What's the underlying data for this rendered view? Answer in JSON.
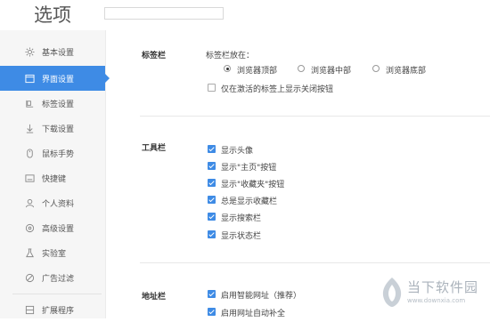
{
  "header": {
    "title": "选项",
    "search_value": ""
  },
  "sidebar": {
    "items": [
      {
        "label": "基本设置",
        "icon": "gear-icon"
      },
      {
        "label": "界面设置",
        "icon": "window-icon"
      },
      {
        "label": "标签设置",
        "icon": "tab-icon"
      },
      {
        "label": "下载设置",
        "icon": "download-icon"
      },
      {
        "label": "鼠标手势",
        "icon": "mouse-icon"
      },
      {
        "label": "快捷键",
        "icon": "keyboard-icon"
      },
      {
        "label": "个人资料",
        "icon": "person-icon"
      },
      {
        "label": "高级设置",
        "icon": "advanced-icon"
      },
      {
        "label": "实验室",
        "icon": "lab-icon"
      },
      {
        "label": "广告过滤",
        "icon": "block-icon"
      },
      {
        "label": "扩展程序",
        "icon": "extension-icon"
      }
    ],
    "active_index": 1
  },
  "tabbar": {
    "title": "标签栏",
    "position_label": "标签栏放在：",
    "positions": [
      "浏览器顶部",
      "浏览器中部",
      "浏览器底部"
    ],
    "selected_position": 0,
    "close_btn_label": "仅在激活的标签上显示关闭按钮",
    "close_btn_checked": false
  },
  "toolbar": {
    "title": "工具栏",
    "options": [
      {
        "label": "显示头像",
        "checked": true
      },
      {
        "label": "显示\"主页\"按钮",
        "checked": true
      },
      {
        "label": "显示\"收藏夹\"按钮",
        "checked": true
      },
      {
        "label": "总是显示收藏栏",
        "checked": true
      },
      {
        "label": "显示搜索栏",
        "checked": true
      },
      {
        "label": "显示状态栏",
        "checked": true
      }
    ]
  },
  "addressbar": {
    "title": "地址栏",
    "options": [
      {
        "label": "启用智能网址（推荐）",
        "checked": true
      },
      {
        "label": "启用网址自动补全",
        "checked": true
      }
    ]
  },
  "watermark": {
    "line1": "当下软件园",
    "line2": "www.downxia.com"
  },
  "colors": {
    "accent": "#3e8be5",
    "sidebar_bg": "#f6f6f6"
  }
}
